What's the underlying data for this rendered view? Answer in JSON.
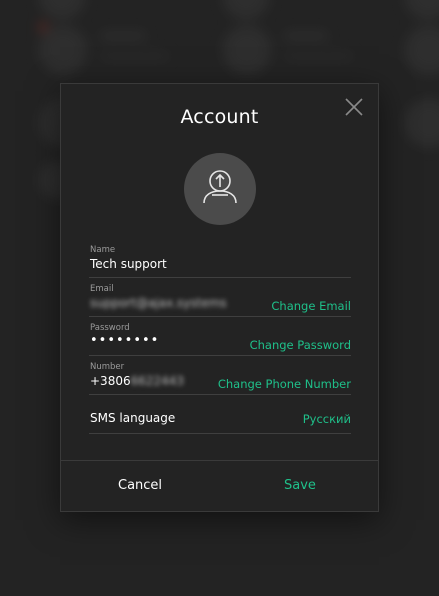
{
  "dialog": {
    "title": "Account",
    "cancel_label": "Cancel",
    "save_label": "Save"
  },
  "fields": {
    "name": {
      "label": "Name",
      "value": "Tech support"
    },
    "email": {
      "label": "Email",
      "value": "support@ajax.systems",
      "action": "Change Email"
    },
    "password": {
      "label": "Password",
      "value": "••••••••",
      "action": "Change Password"
    },
    "number": {
      "label": "Number",
      "value_prefix": "+3806",
      "value_hidden": "6622443",
      "action": "Change Phone Number"
    },
    "sms_language": {
      "label": "SMS language",
      "action": "Русский"
    }
  },
  "colors": {
    "accent": "#1fc08a",
    "dialog_bg": "#232323",
    "avatar_bg": "#4b4b4b"
  },
  "icons": {
    "close": "close-icon",
    "avatar": "upload-photo-icon"
  }
}
